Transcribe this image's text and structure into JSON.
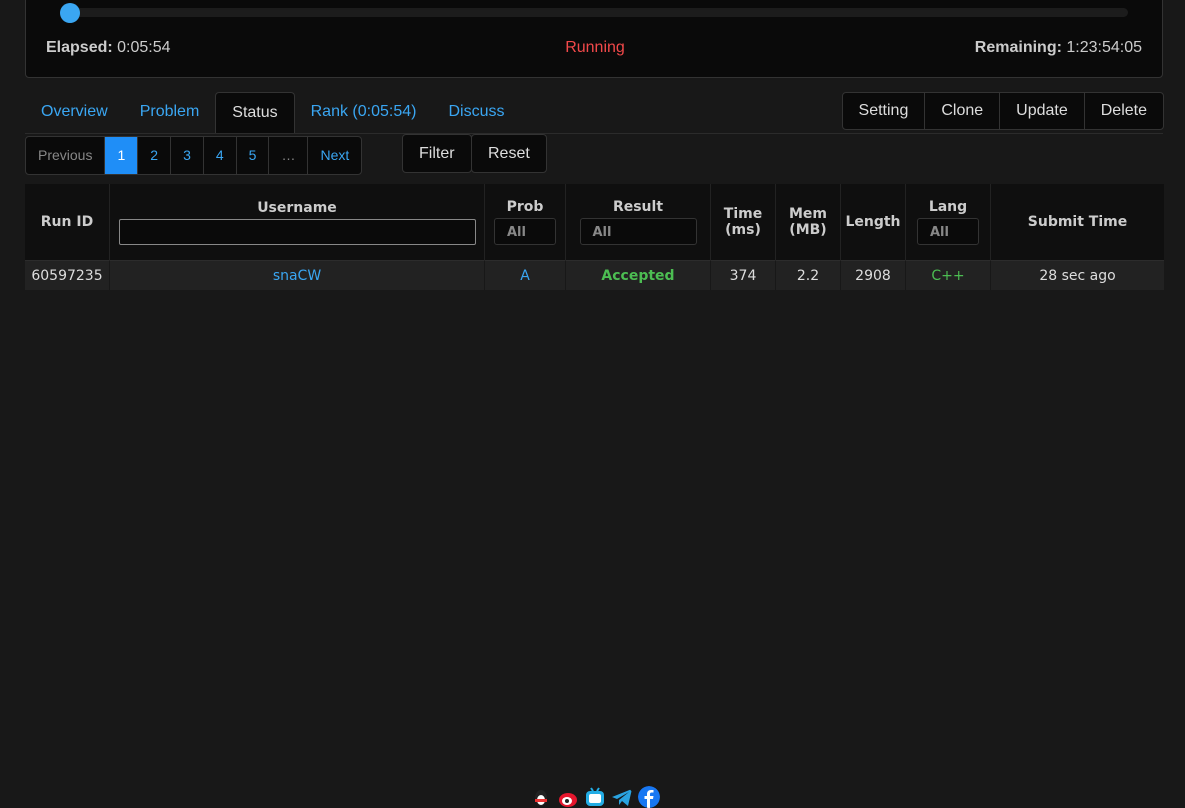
{
  "contest": {
    "progress_fraction": 0.0035,
    "elapsed_label": "Elapsed:",
    "elapsed": "0:05:54",
    "status": "Running",
    "remaining_label": "Remaining:",
    "remaining": "1:23:54:05"
  },
  "tabs": [
    {
      "label": "Overview"
    },
    {
      "label": "Problem"
    },
    {
      "label": "Status"
    },
    {
      "label": "Rank (0:05:54)"
    },
    {
      "label": "Discuss"
    }
  ],
  "admin": {
    "setting": "Setting",
    "clone": "Clone",
    "update": "Update",
    "delete": "Delete"
  },
  "pager": {
    "previous": "Previous",
    "pages": [
      "1",
      "2",
      "3",
      "4",
      "5"
    ],
    "ellipsis": "…",
    "next": "Next"
  },
  "filter": {
    "filter": "Filter",
    "reset": "Reset"
  },
  "table": {
    "headers": {
      "run_id": "Run ID",
      "username": "Username",
      "prob": "Prob",
      "result": "Result",
      "time_1": "Time",
      "time_2": "(ms)",
      "mem_1": "Mem",
      "mem_2": "(MB)",
      "length": "Length",
      "lang": "Lang",
      "submit_time": "Submit Time"
    },
    "filters": {
      "prob": "All",
      "result": "All",
      "lang": "All"
    },
    "rows": [
      {
        "run_id": "60597235",
        "username": "snaCW",
        "prob": "A",
        "result": "Accepted",
        "time": "374",
        "mem": "2.2",
        "length": "2908",
        "lang": "C++",
        "submit_time": "28 sec ago"
      }
    ]
  },
  "colors": {
    "accent": "#3aa6f2",
    "running": "#f2494a",
    "accepted": "#4cbd52"
  },
  "footer_icons": [
    "qq-icon",
    "weibo-icon",
    "bilibili-icon",
    "telegram-icon",
    "facebook-icon"
  ]
}
